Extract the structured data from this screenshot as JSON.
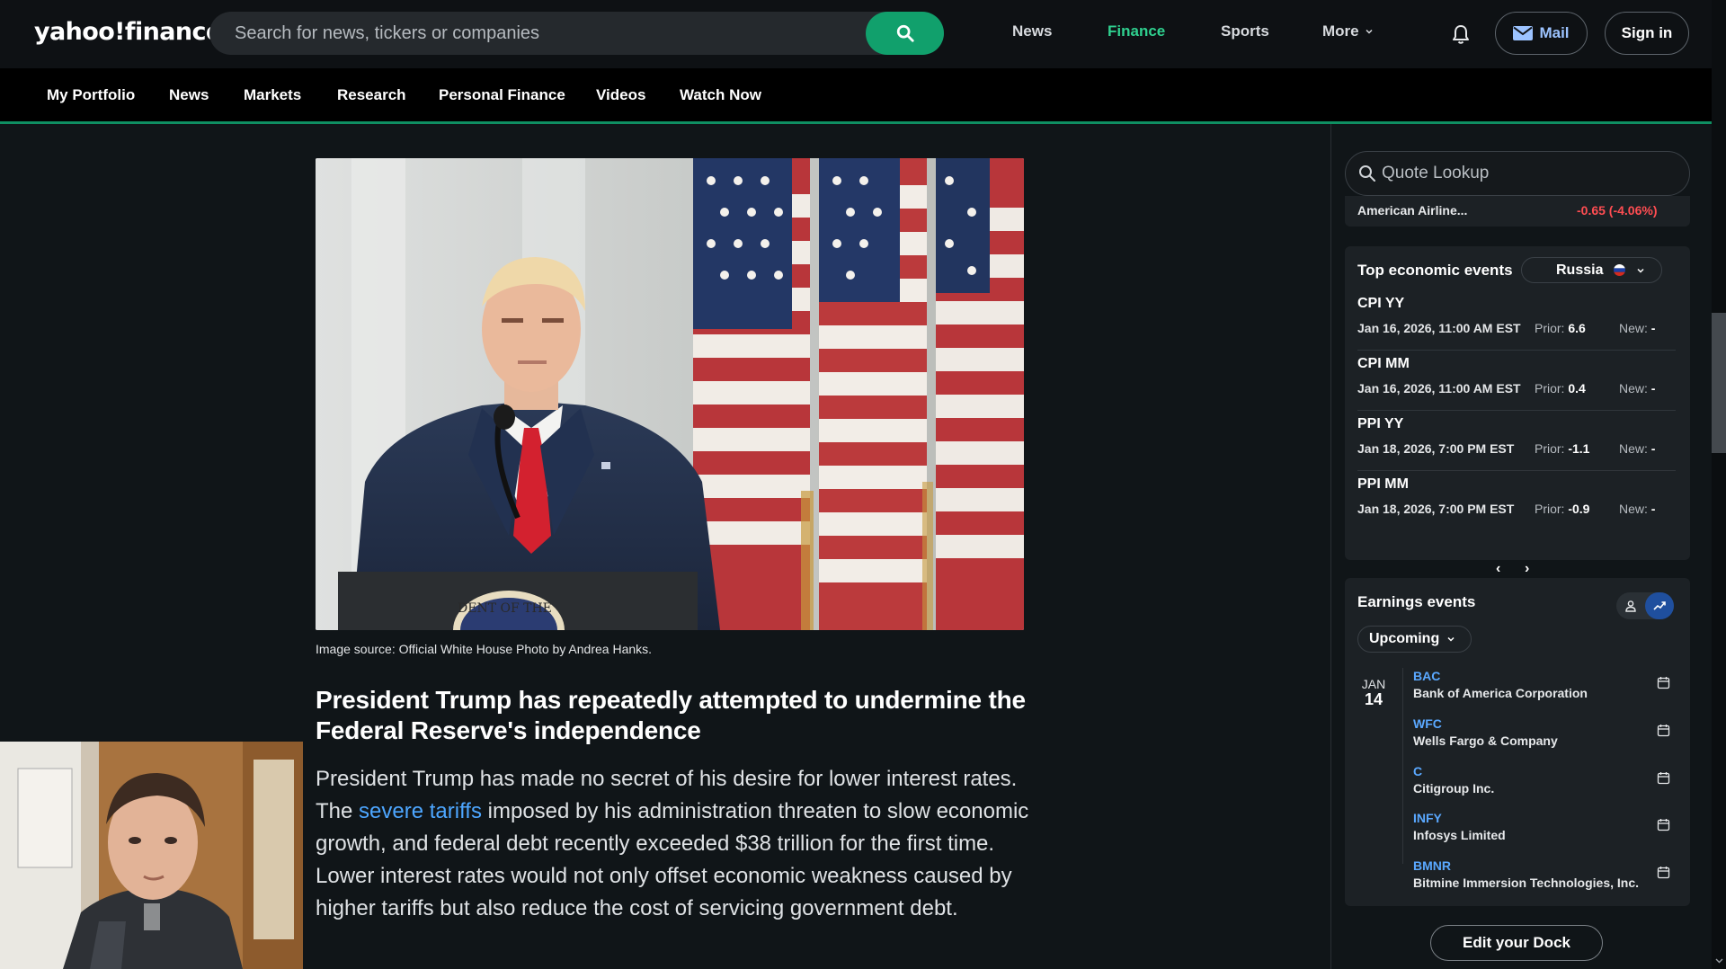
{
  "header": {
    "logo_text": "yahoo!finance",
    "search_placeholder": "Search for news, tickers or companies",
    "nav": [
      "News",
      "Finance",
      "Sports",
      "More"
    ],
    "active_nav": "Finance",
    "mail_label": "Mail",
    "signin_label": "Sign in"
  },
  "subnav": [
    "My Portfolio",
    "News",
    "Markets",
    "Research",
    "Personal Finance",
    "Videos",
    "Watch Now"
  ],
  "article": {
    "image_caption": "Image source: Official White House Photo by Andrea Hanks.",
    "seal_text": "DENT OF THE",
    "headline": "President Trump has repeatedly attempted to undermine the Federal Reserve's independence",
    "body_before_link": "President Trump has made no secret of his desire for lower interest rates. The ",
    "body_link": "severe tariffs",
    "body_after_link": " imposed by his administration threaten to slow economic growth, and federal debt recently exceeded $38 trillion for the first time. Lower interest rates would not only offset economic weakness caused by higher tariffs but also reduce the cost of servicing government debt."
  },
  "rail": {
    "quote_placeholder": "Quote Lookup",
    "ticker": {
      "name": "American Airline...",
      "change": "-0.65 (-4.06%)"
    },
    "economic": {
      "title": "Top economic events",
      "country": "Russia",
      "events": [
        {
          "name": "CPI YY",
          "date": "Jan 16, 2026, 11:00 AM EST",
          "prior_label": "Prior:",
          "prior": "6.6",
          "new_label": "New:",
          "new": "-"
        },
        {
          "name": "CPI MM",
          "date": "Jan 16, 2026, 11:00 AM EST",
          "prior_label": "Prior:",
          "prior": "0.4",
          "new_label": "New:",
          "new": "-"
        },
        {
          "name": "PPI YY",
          "date": "Jan 18, 2026, 7:00 PM EST",
          "prior_label": "Prior:",
          "prior": "-1.1",
          "new_label": "New:",
          "new": "-"
        },
        {
          "name": "PPI MM",
          "date": "Jan 18, 2026, 7:00 PM EST",
          "prior_label": "Prior:",
          "prior": "-0.9",
          "new_label": "New:",
          "new": "-"
        }
      ],
      "prev": "‹",
      "next": "›"
    },
    "earnings": {
      "title": "Earnings events",
      "filter": "Upcoming",
      "month": "JAN",
      "day": "14",
      "items": [
        {
          "symbol": "BAC",
          "company": "Bank of America Corporation"
        },
        {
          "symbol": "WFC",
          "company": "Wells Fargo & Company"
        },
        {
          "symbol": "C",
          "company": "Citigroup Inc."
        },
        {
          "symbol": "INFY",
          "company": "Infosys Limited"
        },
        {
          "symbol": "BMNR",
          "company": "Bitmine Immersion Technologies, Inc."
        }
      ]
    },
    "edit_dock_label": "Edit your Dock"
  },
  "colors": {
    "accent_green": "#11a06c",
    "active_nav": "#2fd08f",
    "link_blue": "#4da6ff",
    "negative_red": "#ff4d52"
  }
}
